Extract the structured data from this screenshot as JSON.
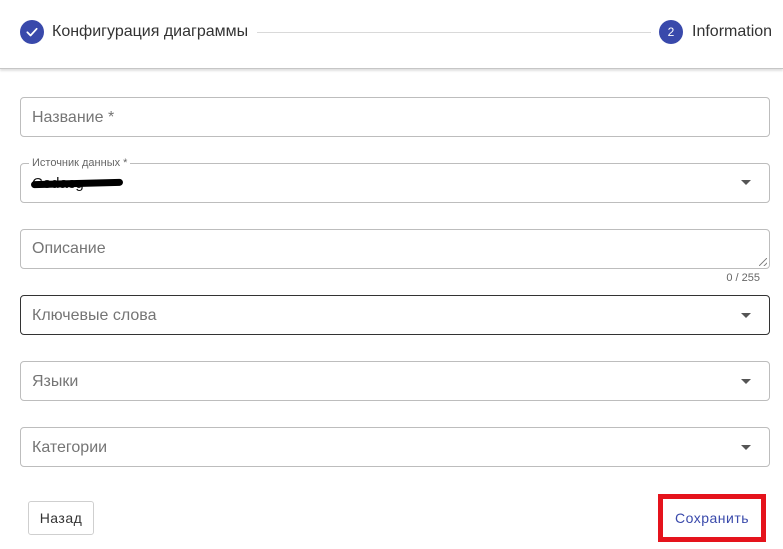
{
  "stepper": {
    "step1": {
      "label": "Конфигурация диаграммы",
      "icon": "check-icon"
    },
    "step2": {
      "number": "2",
      "label": "Information"
    }
  },
  "form": {
    "name": {
      "placeholder": "Название *"
    },
    "source": {
      "label": "Источник данных *",
      "value": "Codacg",
      "redacted": true
    },
    "description": {
      "placeholder": "Описание",
      "counter": "0 / 255"
    },
    "keywords": {
      "placeholder": "Ключевые слова"
    },
    "languages": {
      "placeholder": "Языки"
    },
    "categories": {
      "placeholder": "Категории"
    }
  },
  "actions": {
    "back_label": "Назад",
    "save_label": "Сохранить"
  },
  "colors": {
    "accent": "#3949ab",
    "highlight": "#e5131c"
  }
}
